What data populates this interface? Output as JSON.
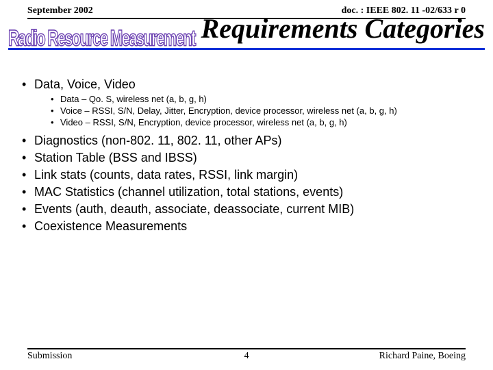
{
  "header": {
    "left": "September 2002",
    "right": "doc. : IEEE 802. 11 -02/633 r 0"
  },
  "wordart": "Radio Resource Measurement",
  "title": "Requirements Categories",
  "bullets": {
    "first": {
      "label": "Data, Voice, Video",
      "sub": [
        "Data – Qo. S, wireless net (a, b, g, h)",
        "Voice – RSSI, S/N, Delay, Jitter, Encryption, device processor, wireless net (a, b, g, h)",
        "Video – RSSI, S/N, Encryption, device processor, wireless net (a, b, g, h)"
      ]
    },
    "rest": [
      "Diagnostics (non-802. 11, 802. 11, other APs)",
      "Station Table (BSS and IBSS)",
      "Link stats (counts, data rates, RSSI, link margin)",
      "MAC Statistics (channel utilization, total stations, events)",
      "Events (auth, deauth, associate, deassociate, current MIB)",
      "Coexistence Measurements"
    ]
  },
  "footer": {
    "left": "Submission",
    "center": "4",
    "right": "Richard Paine, Boeing"
  }
}
